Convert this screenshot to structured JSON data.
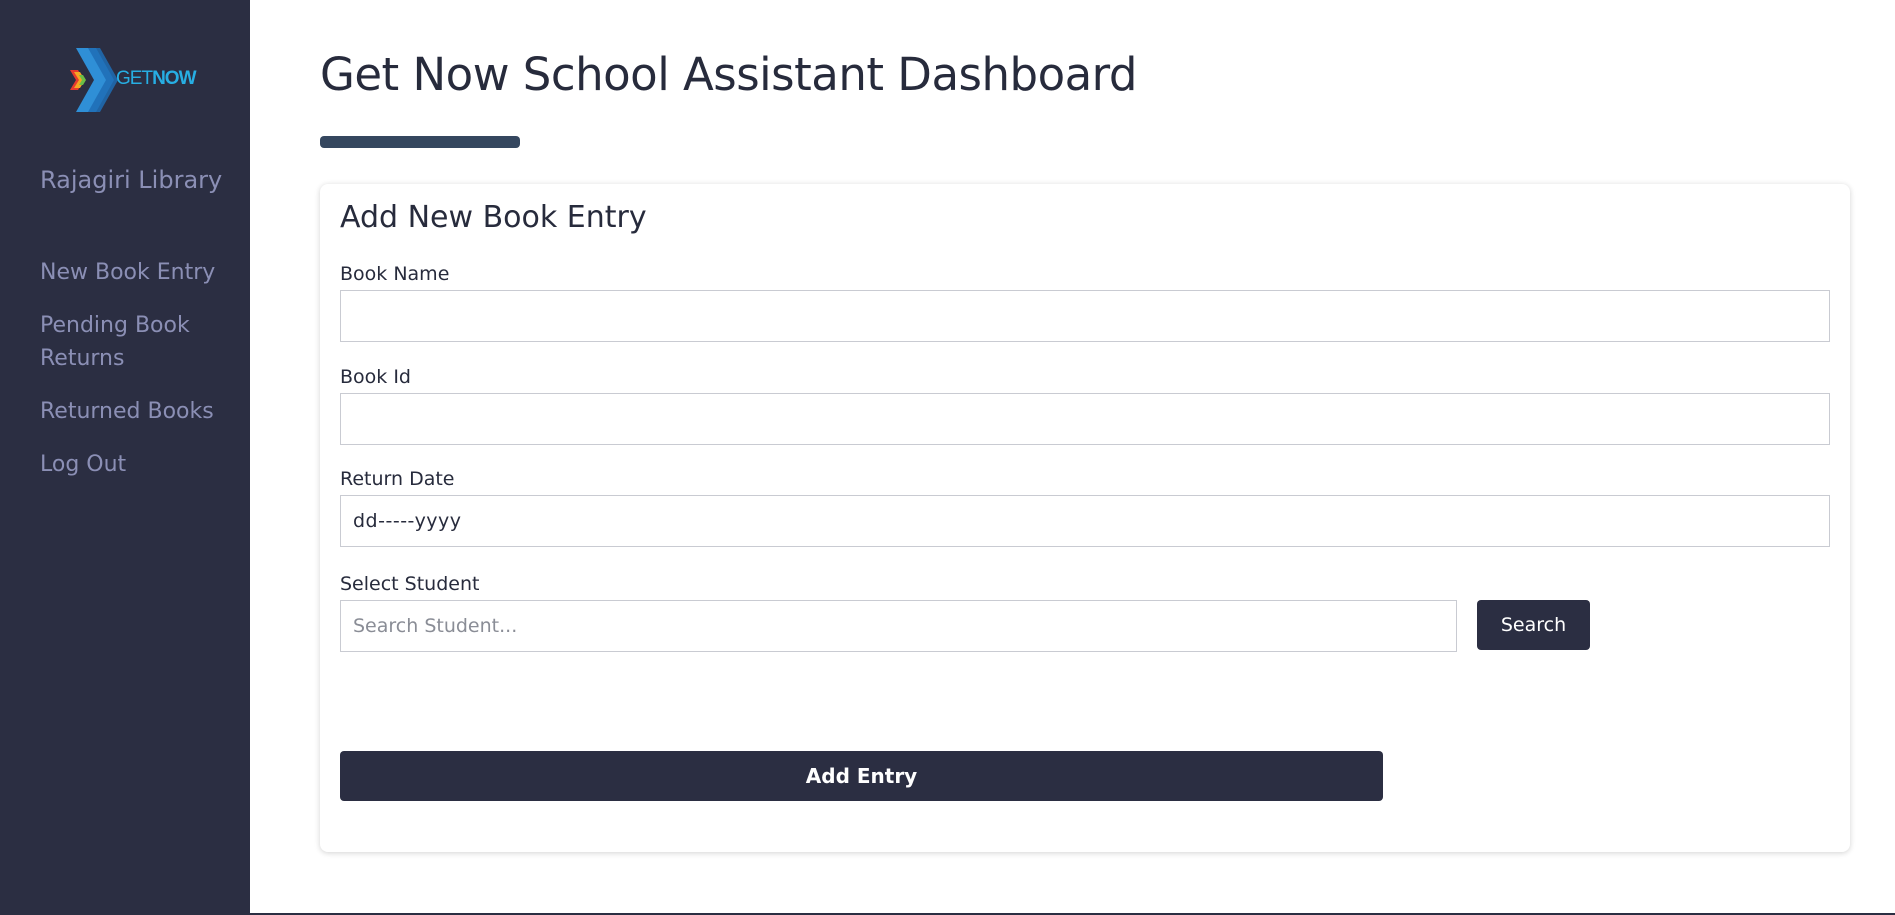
{
  "sidebar": {
    "logo": {
      "text_a": "GET",
      "text_b": "NOW",
      "icon": "getnow-chevron-logo"
    },
    "library_name": "Rajagiri Library",
    "items": [
      {
        "label": "New Book Entry"
      },
      {
        "label": "Pending Book Returns"
      },
      {
        "label": "Returned Books"
      },
      {
        "label": "Log Out"
      }
    ]
  },
  "header": {
    "title": "Get Now School Assistant Dashboard"
  },
  "form": {
    "title": "Add New Book Entry",
    "book_name": {
      "label": "Book Name",
      "value": ""
    },
    "book_id": {
      "label": "Book Id",
      "value": ""
    },
    "return_date": {
      "label": "Return Date",
      "placeholder": "dd-----yyyy"
    },
    "student": {
      "label": "Select Student",
      "placeholder": "Search Student...",
      "search_label": "Search"
    },
    "submit_label": "Add Entry"
  },
  "colors": {
    "sidebar_bg": "#2b2e42",
    "sidebar_text": "#8b8fb5",
    "accent_bar": "#35475f",
    "button_bg": "#2b2e42",
    "logo_blue": "#27aee3"
  }
}
